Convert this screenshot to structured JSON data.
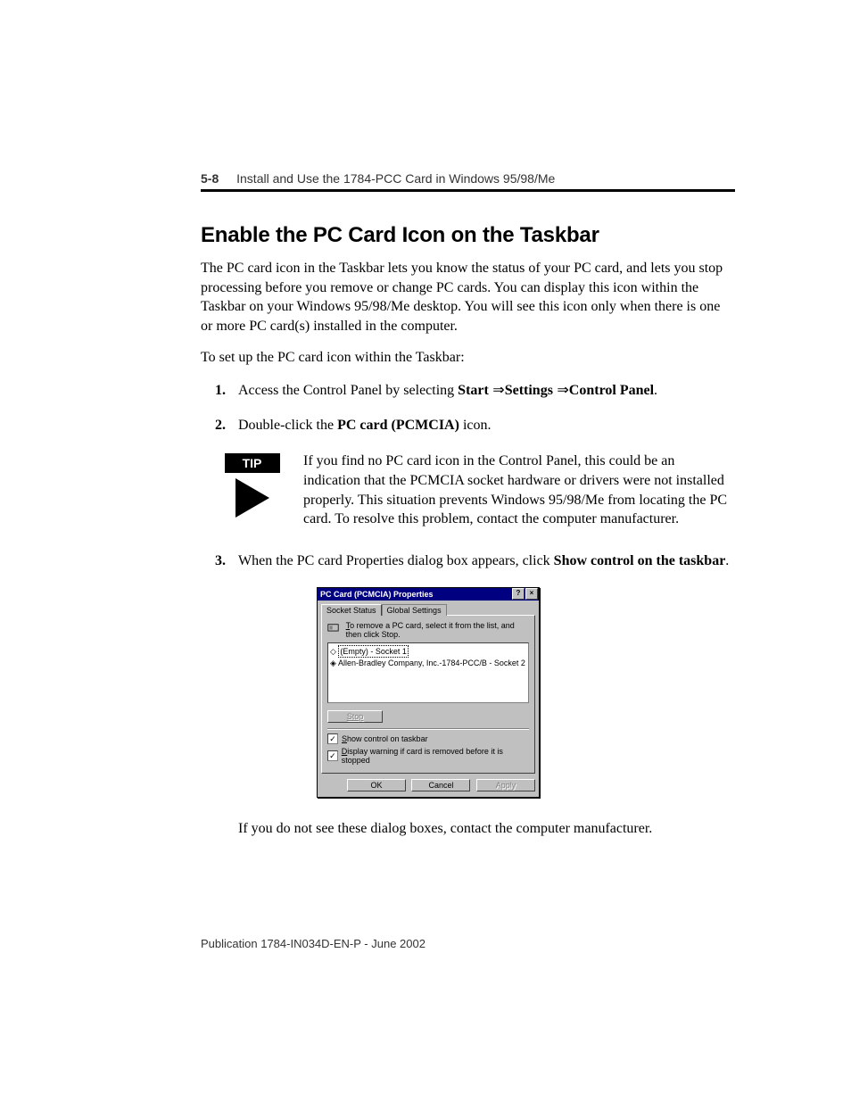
{
  "header": {
    "page_number": "5-8",
    "chapter_title": "Install and Use the 1784-PCC Card in Windows 95/98/Me"
  },
  "section_heading": "Enable the PC Card Icon on the Taskbar",
  "paragraph1": "The PC card icon in the Taskbar lets you know the status of your PC card, and lets you stop processing before you remove or change PC cards. You can display this icon within the Taskbar on your Windows 95/98/Me desktop. You will see this icon only when there is one or more PC card(s) installed in the computer.",
  "paragraph2": "To set up the PC card icon within the Taskbar:",
  "steps": {
    "s1_pre": "Access the Control Panel by selecting ",
    "s1_b1": "Start",
    "s1_arr": " ⇒",
    "s1_b2": "Settings",
    "s1_b3": "Control Panel",
    "s1_period": ".",
    "s2_pre": "Double-click the ",
    "s2_b": "PC card (PCMCIA)",
    "s2_post": " icon.",
    "s3_pre": "When the PC card Properties dialog box appears, click ",
    "s3_b": "Show control on the taskbar",
    "s3_post": "."
  },
  "tip": {
    "badge": "TIP",
    "text": "If you find no PC card icon in the Control Panel, this could be an indication that the PCMCIA socket hardware or drivers were not installed properly. This situation prevents Windows 95/98/Me from locating the PC card. To resolve this problem, contact the computer manufacturer."
  },
  "dialog": {
    "title": "PC Card (PCMCIA) Properties",
    "tabs": {
      "active": "Socket Status",
      "other": "Global Settings"
    },
    "hint_pre": "T",
    "hint_rest": "o remove a PC card, select it from the list, and then click Stop.",
    "list": {
      "item1": "(Empty) - Socket 1",
      "item2": "Allen-Bradley Company, Inc.-1784-PCC/B - Socket 2"
    },
    "stop_btn": "Stop",
    "chk1_pre": "S",
    "chk1_rest": "how control on taskbar",
    "chk2_pre": "D",
    "chk2_rest": "isplay warning if card is removed before it is stopped",
    "ok": "OK",
    "cancel": "Cancel",
    "apply": "Apply"
  },
  "after_dialog": "If you do not see these dialog boxes, contact the computer manufacturer.",
  "publication": "Publication 1784-IN034D-EN-P - June 2002"
}
